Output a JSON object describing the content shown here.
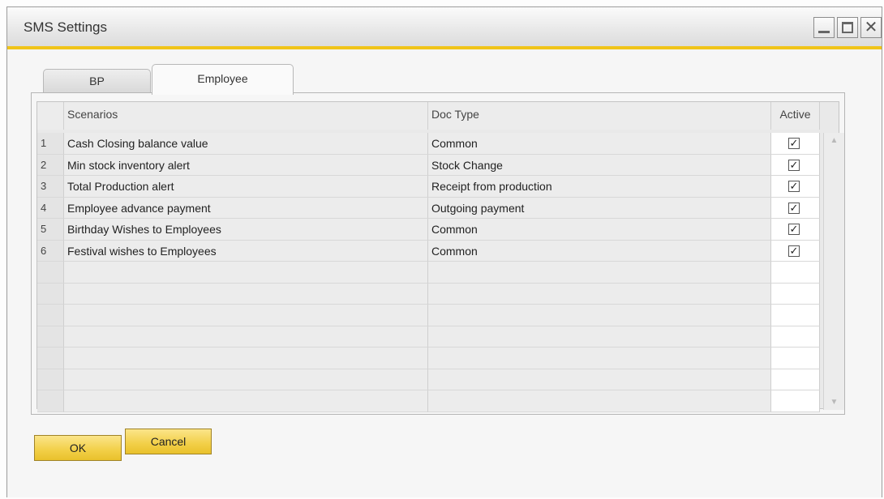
{
  "window": {
    "title": "SMS Settings",
    "controls": {
      "minimize_icon": "minimize-icon",
      "maximize_icon": "maximize-icon",
      "close_icon": "close-icon",
      "close_glyph": "✕"
    }
  },
  "tabs": [
    {
      "label": "BP",
      "active": false
    },
    {
      "label": "Employee",
      "active": true
    }
  ],
  "grid": {
    "columns": {
      "row_num": "",
      "scenarios": "Scenarios",
      "doc_type": "Doc Type",
      "active": "Active"
    },
    "rows": [
      {
        "num": "1",
        "scenario": "Cash Closing balance value",
        "doc_type": "Common",
        "active": true
      },
      {
        "num": "2",
        "scenario": "Min stock inventory alert",
        "doc_type": "Stock Change",
        "active": true
      },
      {
        "num": "3",
        "scenario": "Total Production alert",
        "doc_type": "Receipt from production",
        "active": true
      },
      {
        "num": "4",
        "scenario": "Employee advance payment",
        "doc_type": "Outgoing payment",
        "active": true
      },
      {
        "num": "5",
        "scenario": "Birthday Wishes to Employees",
        "doc_type": "Common",
        "active": true
      },
      {
        "num": "6",
        "scenario": "Festival wishes to Employees",
        "doc_type": "Common",
        "active": true
      }
    ],
    "check_glyph": "✓"
  },
  "buttons": {
    "ok": "OK",
    "cancel": "Cancel"
  },
  "colors": {
    "accent": "#f0c419",
    "button_fill": "#f2cf47"
  }
}
